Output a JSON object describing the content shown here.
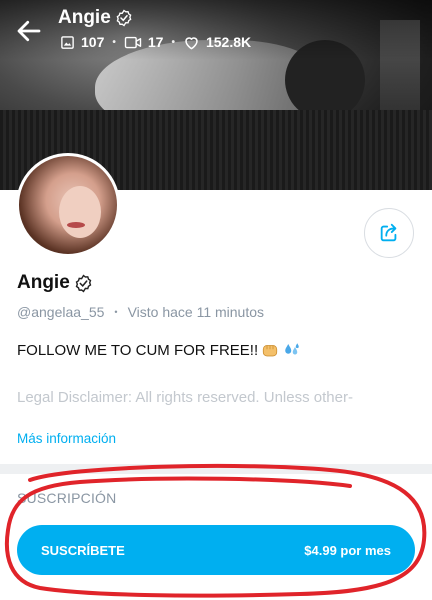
{
  "profile": {
    "name": "Angie",
    "stats": {
      "photos": "107",
      "videos": "17",
      "likes": "152.8K"
    },
    "handle": "@angelaa_55",
    "last_seen": "Visto  hace 11 minutos",
    "bio": "FOLLOW ME TO CUM FOR FREE!!",
    "disclaimer": "Legal Disclaimer: All rights reserved. Unless other-",
    "more_info": "Más información"
  },
  "subscription": {
    "title": "SUSCRIPCIÓN",
    "button_label": "SUSCRÍBETE",
    "price": "$4.99 por mes"
  },
  "colors": {
    "accent": "#00aff0",
    "muted": "#8a96a3",
    "annotation": "#e0242a"
  },
  "icons": [
    "back-arrow-icon",
    "verified-icon",
    "image-icon",
    "video-icon",
    "heart-icon",
    "share-icon",
    "fist-emoji",
    "splash-emoji"
  ]
}
